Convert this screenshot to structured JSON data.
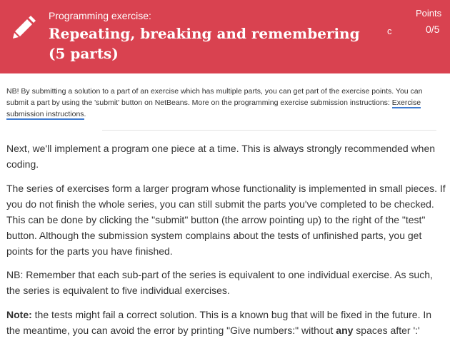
{
  "header": {
    "eyebrow": "Programming exercise:",
    "title": "Repeating, breaking and remembering (5 parts)",
    "refresh_icon": "c",
    "points_label": "Points",
    "points_value": "0/5",
    "background_color": "#d94250"
  },
  "notice": {
    "text": "NB! By submitting a solution to a part of an exercise which has multiple parts, you can get part of the exercise points. You can submit a part by using the 'submit' button on NetBeans. More on the programming exercise submission instructions: ",
    "link_text": "Exercise submission instructions",
    "after_link": "."
  },
  "body": {
    "p1": "Next, we'll implement a program one piece at a time. This is always strongly recommended when coding.",
    "p2": "The series of exercises form a larger program whose functionality is implemented in small pieces. If you do not finish the whole series, you can still submit the parts you've completed to be checked. This can be done by clicking the \"submit\" button (the arrow pointing up) to the right of the \"test\" button. Although the submission system complains about the tests of unfinished parts, you get points for the parts you have finished.",
    "p3": "NB: Remember that each sub-part of the series is equivalent to one individual exercise. As such, the series is equivalent to five individual exercises.",
    "p4_bold": "Note:",
    "p4_a": " the tests might fail a correct solution. This is a known bug that will be fixed in the future. In the meantime, you can avoid the error by printing \"Give numbers:\" without ",
    "p4_bold2": "any",
    "p4_b": " spaces after ':'"
  },
  "icons": {
    "pencil": "pencil-icon",
    "refresh": "refresh-icon"
  }
}
